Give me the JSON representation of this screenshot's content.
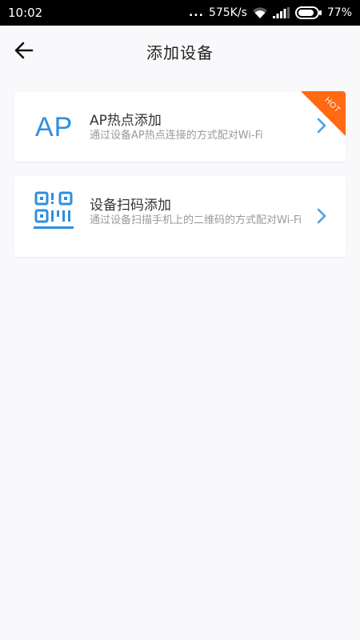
{
  "status_bar": {
    "time": "10:02",
    "dots": "...",
    "speed": "575K/s",
    "battery": "77%",
    "icons": [
      "wifi-icon",
      "signal-icon",
      "battery-icon"
    ]
  },
  "header": {
    "title": "添加设备",
    "back_icon": "arrow-left-icon"
  },
  "options": [
    {
      "logo_text": "AP",
      "title": "AP热点添加",
      "description": "通过设备AP热点连接的方式配对Wi-Fi",
      "badge": "HOT",
      "badge_color": "#ff6a13"
    },
    {
      "logo_icon": "qr-code-icon",
      "title": "设备扫码添加",
      "description": "通过设备扫描手机上的二维码的方式配对Wi-Fi"
    }
  ],
  "colors": {
    "accent": "#2f8fe0",
    "chevron": "#4aa0e8",
    "hot": "#ff6a13"
  }
}
